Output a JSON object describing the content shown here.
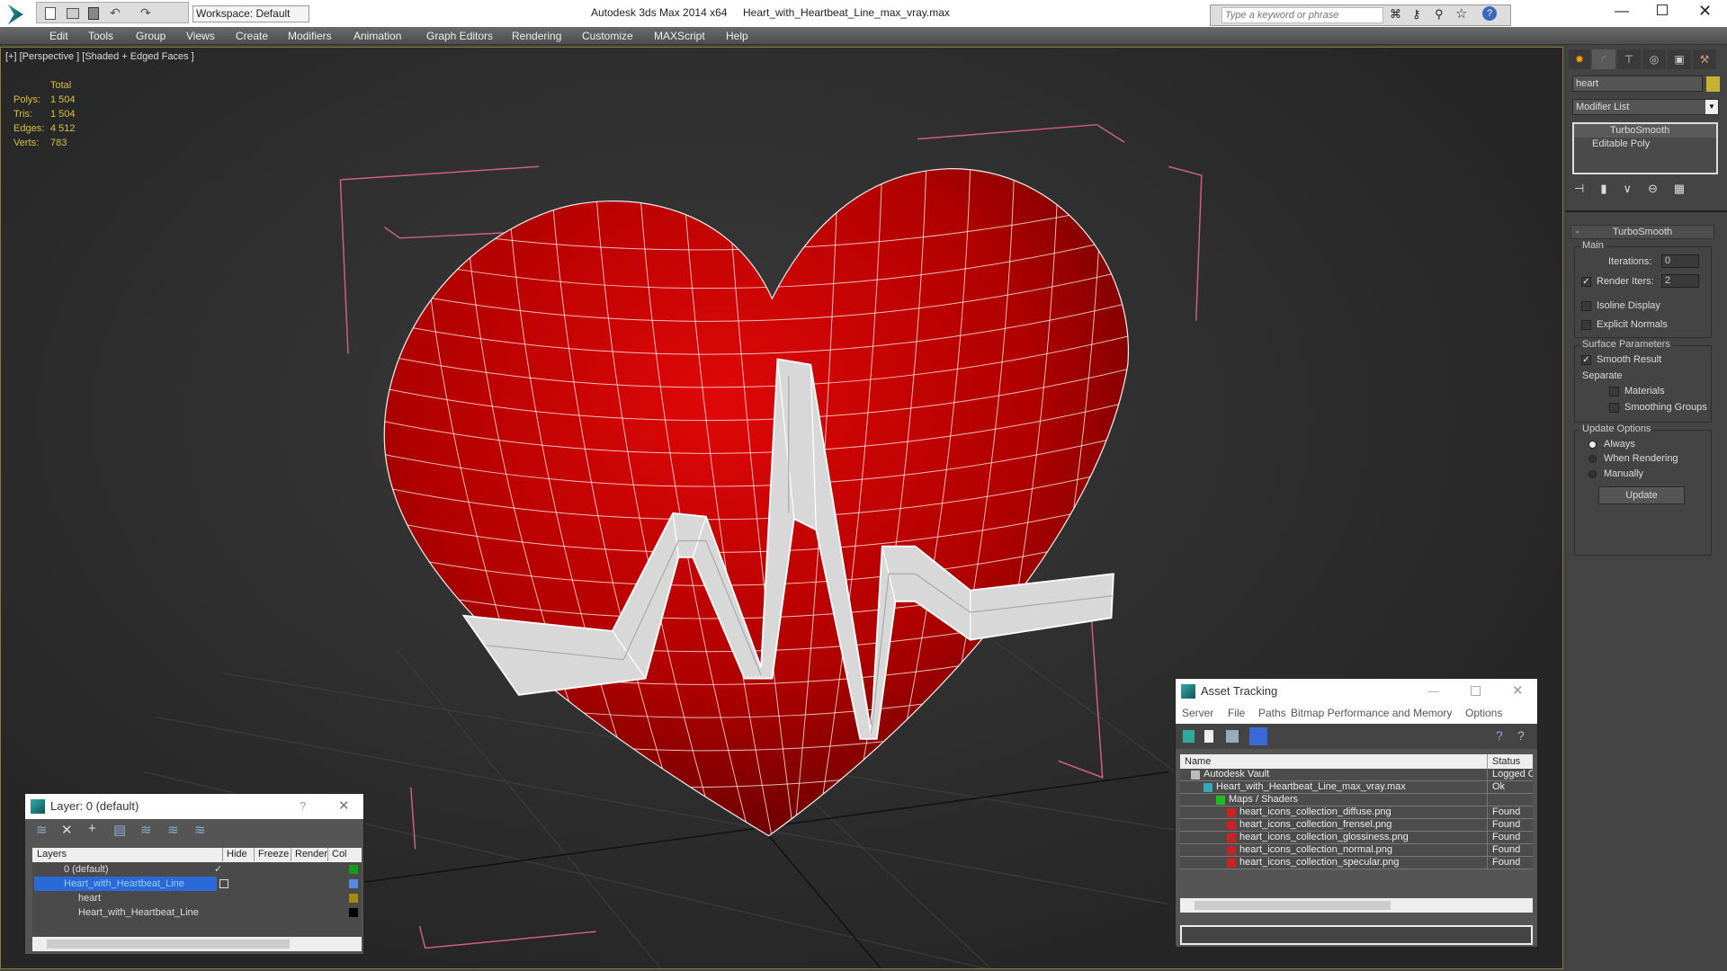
{
  "titlebar": {
    "workspace": "Workspace: Default",
    "app": "Autodesk 3ds Max  2014 x64",
    "file": "Heart_with_Heartbeat_Line_max_vray.max",
    "search_placeholder": "Type a keyword or phrase"
  },
  "menu": [
    "Edit",
    "Tools",
    "Group",
    "Views",
    "Create",
    "Modifiers",
    "Animation",
    "Graph Editors",
    "Rendering",
    "Customize",
    "MAXScript",
    "Help"
  ],
  "viewport": {
    "label": "[+] [Perspective ] [Shaded + Edged Faces ]",
    "stats": {
      "header": "Total",
      "rows": [
        {
          "k": "Polys:",
          "v": "1 504"
        },
        {
          "k": "Tris:",
          "v": "1 504"
        },
        {
          "k": "Edges:",
          "v": "4 512"
        },
        {
          "k": "Verts:",
          "v": "783"
        }
      ]
    }
  },
  "command_panel": {
    "object_name": "heart",
    "object_color": "#c8b030",
    "modifier_list": "Modifier List",
    "stack": [
      "TurboSmooth",
      "Editable Poly"
    ],
    "rollout": "TurboSmooth",
    "main": "Main",
    "iterations_label": "Iterations:",
    "iterations": "0",
    "render_iters_label": "Render Iters:",
    "render_iters": "2",
    "isoline": "Isoline Display",
    "explicit": "Explicit Normals",
    "surface": "Surface Parameters",
    "smooth_result": "Smooth Result",
    "separate": "Separate",
    "materials": "Materials",
    "smoothing_groups": "Smoothing Groups",
    "update_options": "Update Options",
    "always": "Always",
    "when_rendering": "When Rendering",
    "manually": "Manually",
    "update": "Update"
  },
  "layer_dialog": {
    "title": "Layer: 0 (default)",
    "help": "?",
    "columns": [
      "Layers",
      "Hide",
      "Freeze",
      "Render",
      "Col"
    ],
    "rows": [
      {
        "name": "0 (default)",
        "color": "#1a9a1a"
      },
      {
        "name": "Heart_with_Heartbeat_Line",
        "color": "#5a8ae0"
      },
      {
        "name": "heart",
        "color": "#a08a10"
      },
      {
        "name": "Heart_with_Heartbeat_Line",
        "color": "#000000"
      }
    ]
  },
  "asset_dialog": {
    "title": "Asset Tracking",
    "menu": [
      "Server",
      "File",
      "Paths",
      "Bitmap Performance and Memory",
      "Options"
    ],
    "columns": [
      "Name",
      "Status"
    ],
    "rows": [
      {
        "name": "Autodesk Vault",
        "status": "Logged O"
      },
      {
        "name": "Heart_with_Heartbeat_Line_max_vray.max",
        "status": "Ok"
      },
      {
        "name": "Maps / Shaders",
        "status": ""
      },
      {
        "name": "heart_icons_collection_diffuse.png",
        "status": "Found"
      },
      {
        "name": "heart_icons_collection_frensel.png",
        "status": "Found"
      },
      {
        "name": "heart_icons_collection_glossiness.png",
        "status": "Found"
      },
      {
        "name": "heart_icons_collection_normal.png",
        "status": "Found"
      },
      {
        "name": "heart_icons_collection_specular.png",
        "status": "Found"
      }
    ]
  }
}
